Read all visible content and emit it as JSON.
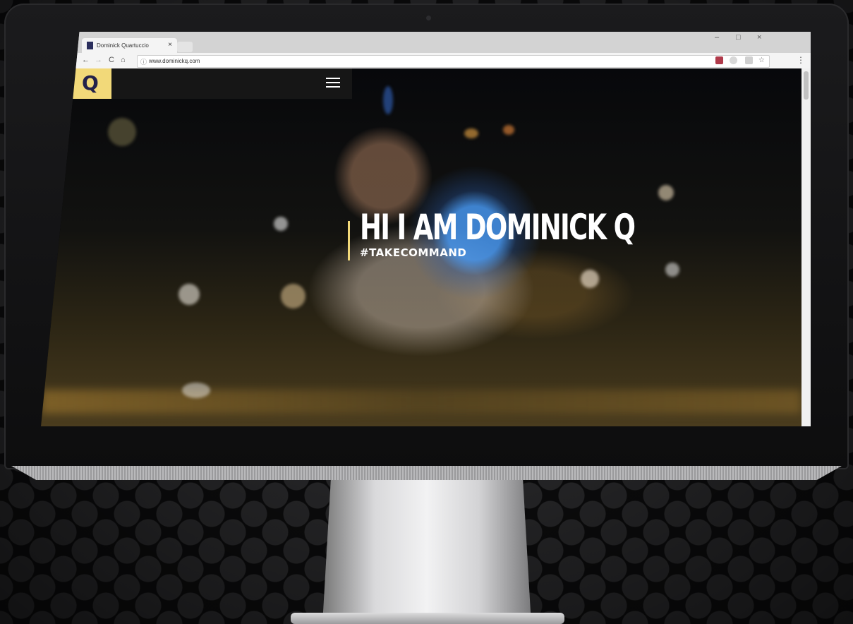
{
  "browser": {
    "tab_title": "Dominick Quartuccio",
    "tab_close": "×",
    "url": "www.dominickq.com",
    "nav": {
      "back": "←",
      "forward": "→",
      "reload": "C",
      "home": "⌂"
    },
    "info_icon": "ⓘ",
    "bookmark_icon": "☆",
    "menu_icon": "⋮",
    "window_controls": {
      "minimize": "–",
      "maximize": "□",
      "close": "×"
    }
  },
  "site": {
    "logo": "Q",
    "hero_title": "HI I AM DOMINICK Q",
    "hero_subtitle": "#TAKECOMMAND"
  },
  "colors": {
    "accent": "#f2d979",
    "logo_text": "#23214a"
  }
}
